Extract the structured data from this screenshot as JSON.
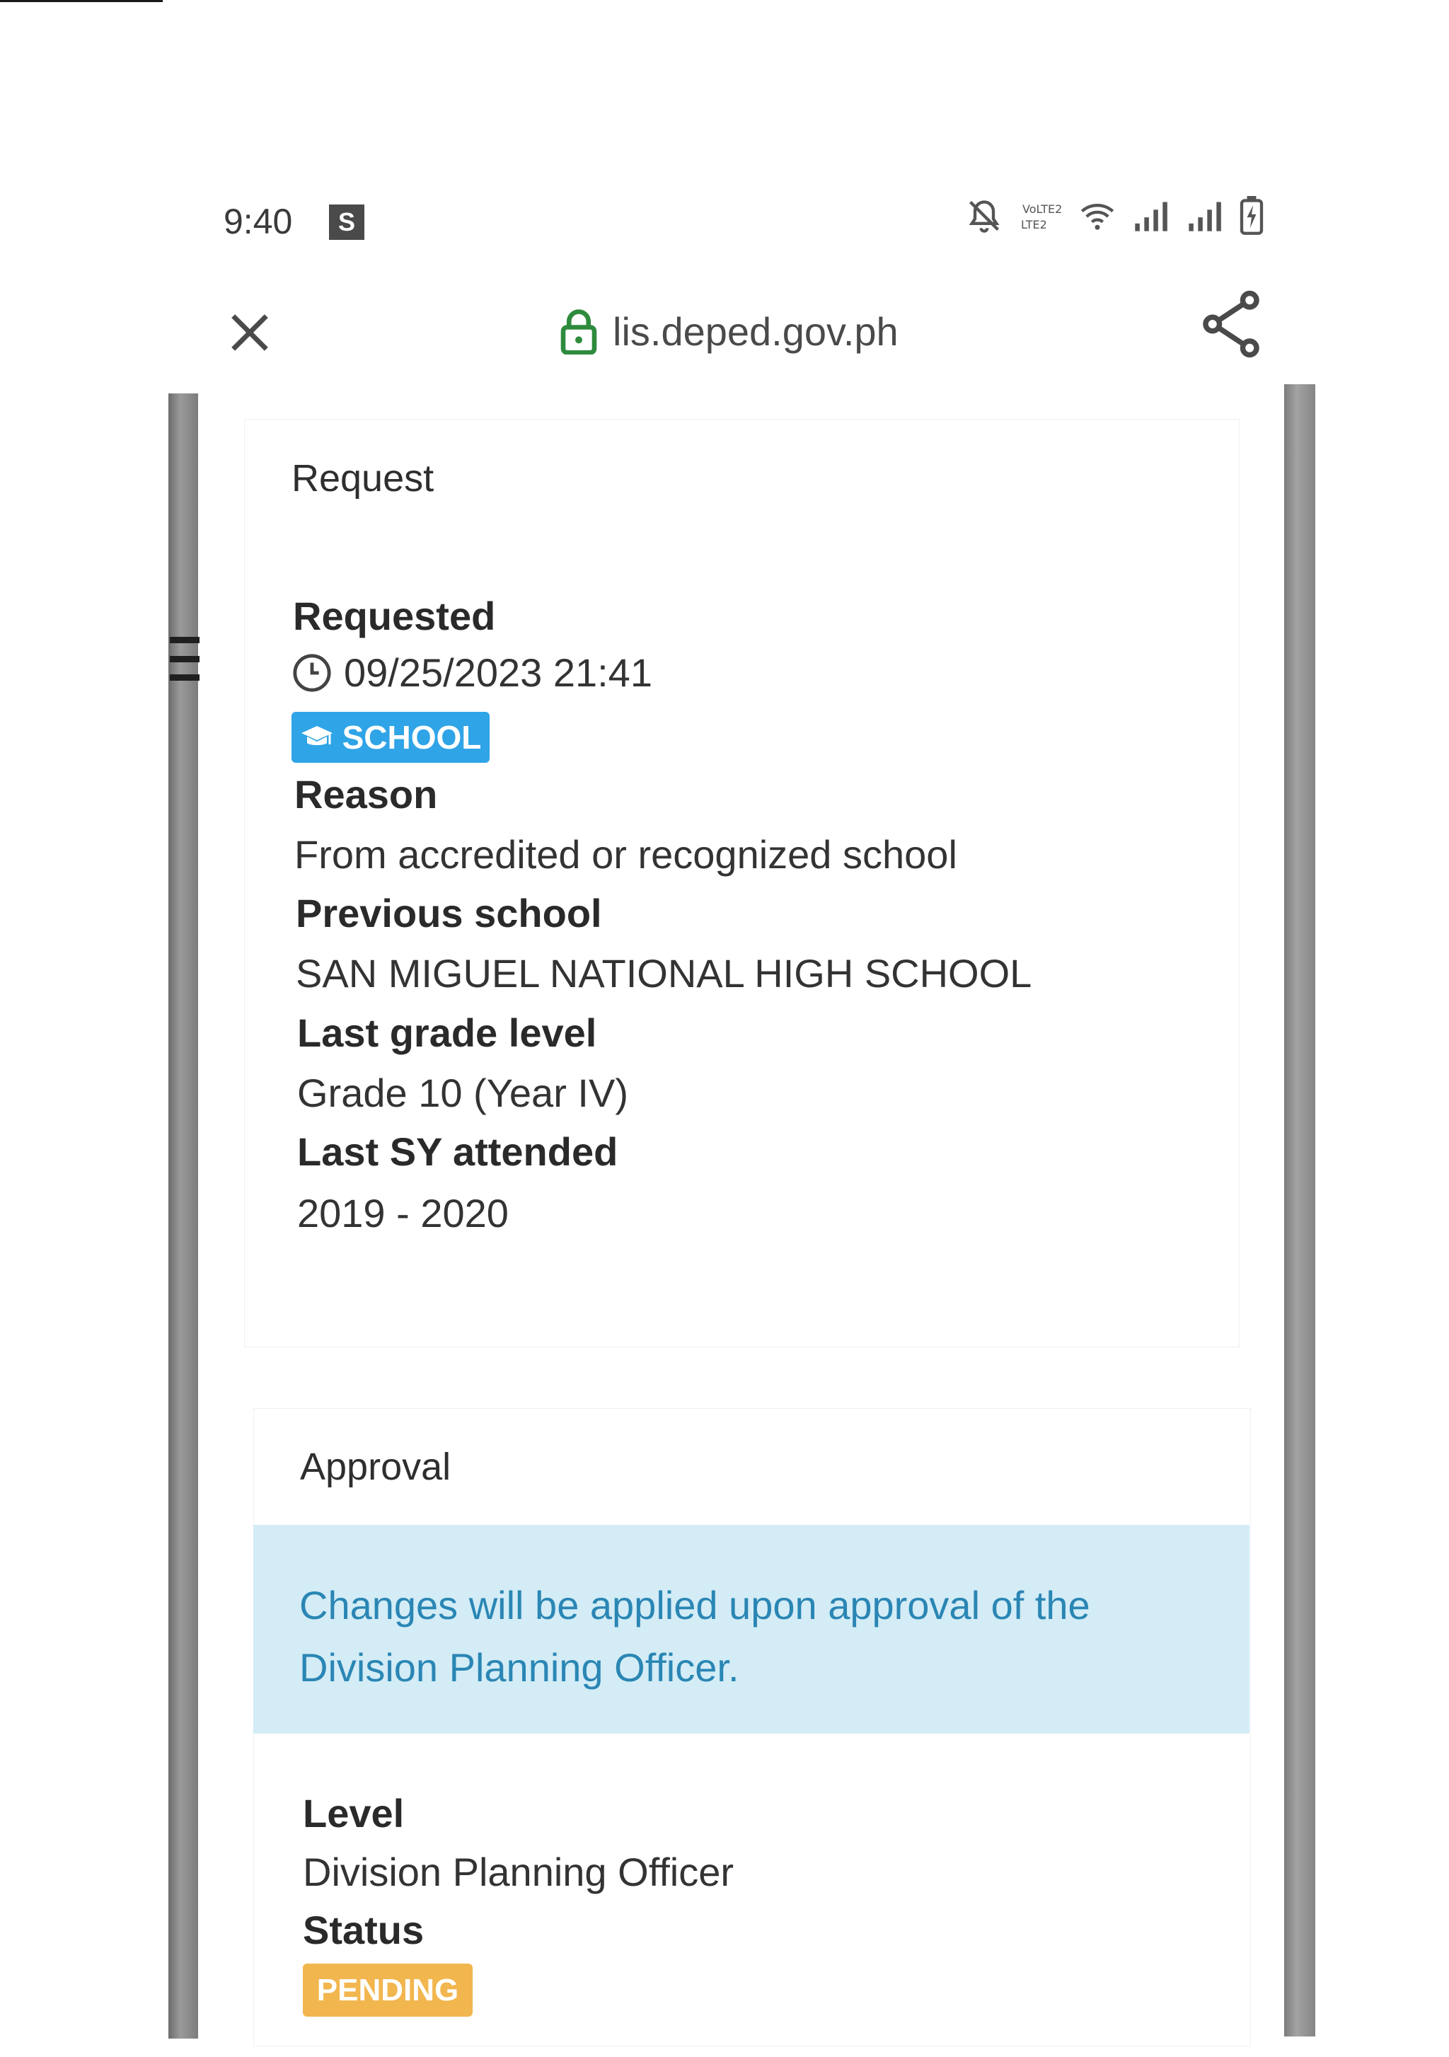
{
  "status_bar": {
    "time": "9:40",
    "app_badge": "S",
    "network_label": "VoLTE2",
    "icons": [
      "mute-icon",
      "volte-icon",
      "wifi-icon",
      "signal-icon",
      "signal-icon",
      "battery-charging-icon"
    ]
  },
  "browser": {
    "url": "lis.deped.gov.ph",
    "icons": {
      "close": "close-icon",
      "lock": "lock-icon",
      "share": "share-icon"
    }
  },
  "request_card": {
    "header": "Request",
    "requested_label": "Requested",
    "requested_datetime": "09/25/2023 21:41",
    "type_badge": "SCHOOL",
    "reason_label": "Reason",
    "reason_value": "From accredited or recognized school",
    "previous_school_label": "Previous school",
    "previous_school_value": "SAN MIGUEL NATIONAL HIGH SCHOOL",
    "last_grade_label": "Last grade level",
    "last_grade_value": "Grade 10 (Year IV)",
    "last_sy_label": "Last SY attended",
    "last_sy_value": "2019 - 2020"
  },
  "approval_card": {
    "header": "Approval",
    "notice": "Changes will be applied upon approval of the Division Planning Officer.",
    "level_label": "Level",
    "level_value": "Division Planning Officer",
    "status_label": "Status",
    "status_badge": "PENDING"
  },
  "colors": {
    "info_blue": "#2fa4e7",
    "info_bg": "#d3ecf6",
    "info_text": "#2a86b4",
    "pending_orange": "#f2b64e",
    "lock_green": "#2e8b3d"
  }
}
